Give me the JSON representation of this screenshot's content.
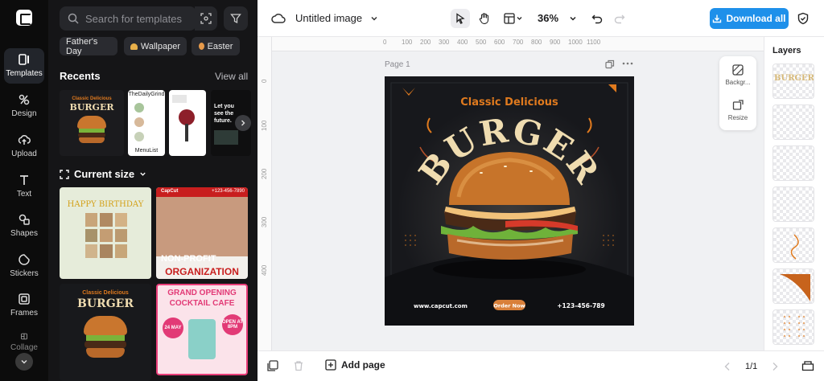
{
  "sidebar": {
    "items": [
      {
        "label": "Templates",
        "icon": "templates-icon"
      },
      {
        "label": "Design",
        "icon": "design-icon"
      },
      {
        "label": "Upload",
        "icon": "upload-icon"
      },
      {
        "label": "Text",
        "icon": "text-icon"
      },
      {
        "label": "Shapes",
        "icon": "shapes-icon"
      },
      {
        "label": "Stickers",
        "icon": "stickers-icon"
      },
      {
        "label": "Frames",
        "icon": "frames-icon"
      },
      {
        "label": "Collage",
        "icon": "collage-icon"
      }
    ]
  },
  "panel": {
    "search": {
      "placeholder": "Search for templates"
    },
    "chips": [
      "Father's Day",
      "Wallpaper",
      "Easter"
    ],
    "recents": {
      "title": "Recents",
      "view_all": "View all"
    },
    "current_size": {
      "title": "Current size"
    },
    "thumbs": {
      "recent_1": {
        "line1": "Classic Delicious",
        "line2": "BURGER"
      },
      "recent_2": {
        "top": "TheDailyGrind",
        "bottom": "MenuList"
      },
      "recent_4": {
        "text": "Let you see the future."
      },
      "card_birthday": {
        "text": "HAPPY BIRTHDAY"
      },
      "card_nonprofit": {
        "brand": "CapCut",
        "phone": "+123-456-7890",
        "line1": "NON-PROFIT",
        "line2": "ORGANIZATION"
      },
      "card_burger": {
        "line1": "Classic Delicious",
        "line2": "BURGER"
      },
      "card_cocktail": {
        "line1": "GRAND OPENING",
        "line2": "COCKTAIL CAFE",
        "badge1": "24 MAY",
        "badge2": "OPEN AT 8PM"
      }
    }
  },
  "toolbar": {
    "title": "Untitled image",
    "zoom": "36%",
    "download_label": "Download all"
  },
  "canvas": {
    "page_label": "Page 1",
    "ruler_marks": [
      "0",
      "100",
      "200",
      "300",
      "400",
      "500",
      "600",
      "700",
      "800",
      "900",
      "1000",
      "1100"
    ],
    "design": {
      "subtitle": "Classic Delicious",
      "title": "BURGER",
      "website": "www.capcut.com",
      "cta": "Order Now",
      "phone": "+123-456-789"
    }
  },
  "float_tools": {
    "background": "Backgr...",
    "resize": "Resize"
  },
  "layers": {
    "title": "Layers",
    "burger_text": "BURGER"
  },
  "bottom": {
    "add_page": "Add page",
    "page_counter": "1/1"
  },
  "colors": {
    "accent": "#1e90ea",
    "burger_orange": "#e07a1e",
    "burger_cream": "#efdcb0"
  }
}
